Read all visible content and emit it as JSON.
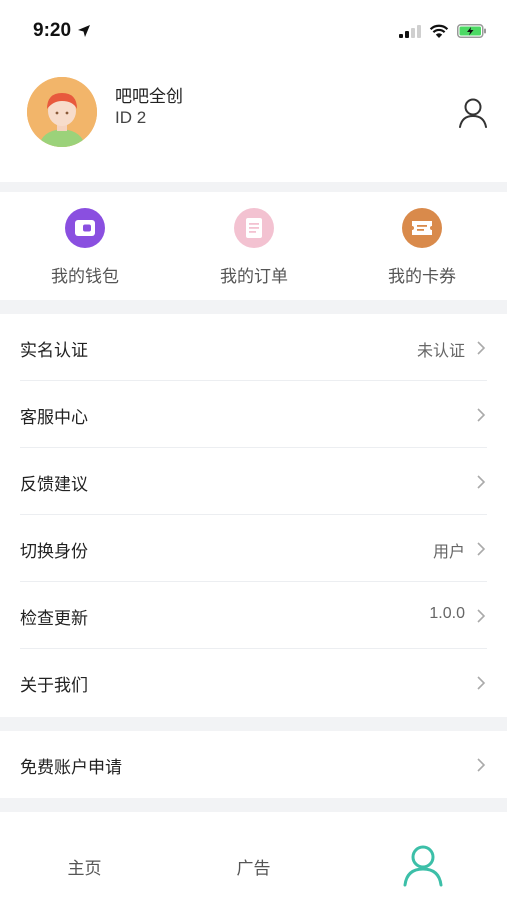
{
  "status_bar": {
    "time": "9:20",
    "location_icon": "location-arrow-icon",
    "signal_icon": "cellular-signal-icon",
    "wifi_icon": "wifi-icon",
    "battery_icon": "battery-charging-icon",
    "battery_color": "#4cd964"
  },
  "profile": {
    "name": "吧吧全创",
    "id": "ID 2",
    "avatar_icon": "avatar-girl-icon",
    "account_icon": "user-outline-icon"
  },
  "shortcuts": [
    {
      "label": "我的钱包",
      "icon": "wallet-icon",
      "color": "#8a4fe0"
    },
    {
      "label": "我的订单",
      "icon": "order-icon",
      "color": "#f3c2d1"
    },
    {
      "label": "我的卡券",
      "icon": "coupon-icon",
      "color": "#d98a4b"
    }
  ],
  "menu": [
    {
      "label": "实名认证",
      "value": "未认证"
    },
    {
      "label": "客服中心",
      "value": ""
    },
    {
      "label": "反馈建议",
      "value": ""
    },
    {
      "label": "切换身份",
      "value": "用户"
    },
    {
      "label": "检查更新",
      "value": "1.0.0"
    },
    {
      "label": "关于我们",
      "value": ""
    }
  ],
  "menu2": [
    {
      "label": "免费账户申请",
      "value": ""
    }
  ],
  "tabbar": {
    "tabs": [
      {
        "label": "主页",
        "icon": ""
      },
      {
        "label": "广告",
        "icon": ""
      },
      {
        "label": "",
        "icon": "user-tab-icon"
      }
    ],
    "active_color": "#3cbfa8"
  }
}
